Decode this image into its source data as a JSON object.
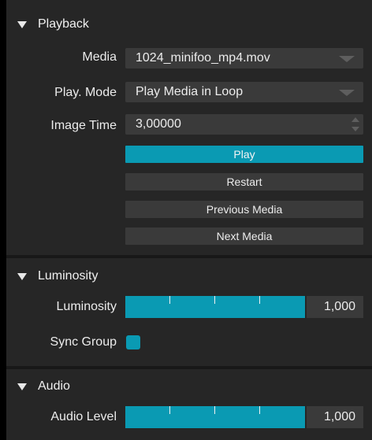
{
  "colors": {
    "accent": "#0a9ab3",
    "panel_bg": "#262626",
    "field_bg": "#3a3a3a",
    "divider": "#181818"
  },
  "playback": {
    "header": "Playback",
    "media_label": "Media",
    "media_value": "1024_minifoo_mp4.mov",
    "play_mode_label": "Play. Mode",
    "play_mode_value": "Play Media in Loop",
    "image_time_label": "Image Time",
    "image_time_value": "3,00000",
    "play_button": "Play",
    "restart_button": "Restart",
    "previous_button": "Previous Media",
    "next_button": "Next Media"
  },
  "luminosity": {
    "header": "Luminosity",
    "luminosity_label": "Luminosity",
    "luminosity_value": "1,000",
    "luminosity_level": 1.0,
    "sync_group_label": "Sync Group",
    "sync_group_checked": true
  },
  "audio": {
    "header": "Audio",
    "audio_level_label": "Audio Level",
    "audio_level_value": "1,000",
    "audio_level": 1.0
  }
}
